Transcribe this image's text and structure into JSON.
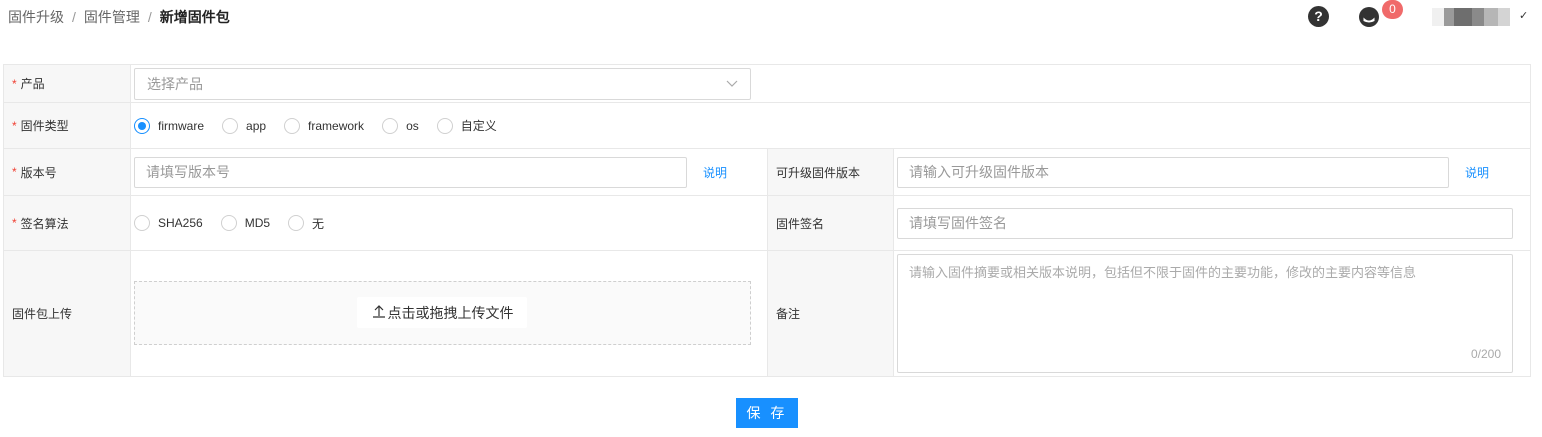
{
  "breadcrumb": {
    "items": [
      "固件升级",
      "固件管理"
    ],
    "current": "新增固件包",
    "separator": "/"
  },
  "header": {
    "help_icon_glyph": "?",
    "message_badge_count": "0",
    "user_caret": "✓"
  },
  "form": {
    "product": {
      "label": "产品",
      "placeholder": "选择产品"
    },
    "firmware_type": {
      "label": "固件类型",
      "options": [
        "firmware",
        "app",
        "framework",
        "os",
        "自定义"
      ],
      "selected": "firmware"
    },
    "version": {
      "label": "版本号",
      "placeholder": "请填写版本号",
      "help_link": "说明"
    },
    "upgradable_version": {
      "label": "可升级固件版本",
      "placeholder": "请输入可升级固件版本",
      "help_link": "说明"
    },
    "sign_algorithm": {
      "label": "签名算法",
      "options": [
        "SHA256",
        "MD5",
        "无"
      ],
      "selected": ""
    },
    "firmware_sign": {
      "label": "固件签名",
      "placeholder": "请填写固件签名"
    },
    "upload": {
      "label": "固件包上传",
      "button_label": "点击或拖拽上传文件"
    },
    "remark": {
      "label": "备注",
      "placeholder": "请输入固件摘要或相关版本说明，包括但不限于固件的主要功能，修改的主要内容等信息",
      "char_count": "0/200"
    },
    "required_mark": "*"
  },
  "actions": {
    "save_label": "保 存"
  },
  "colors": {
    "primary": "#1890ff",
    "required": "#f04134",
    "badge": "#f06a6a",
    "label_bg": "#f7f7f7",
    "border": "#e8e8e8"
  },
  "icons": {
    "help": "help-icon",
    "message": "message-icon",
    "dropdown": "chevron-down-icon",
    "upload": "upload-icon"
  }
}
